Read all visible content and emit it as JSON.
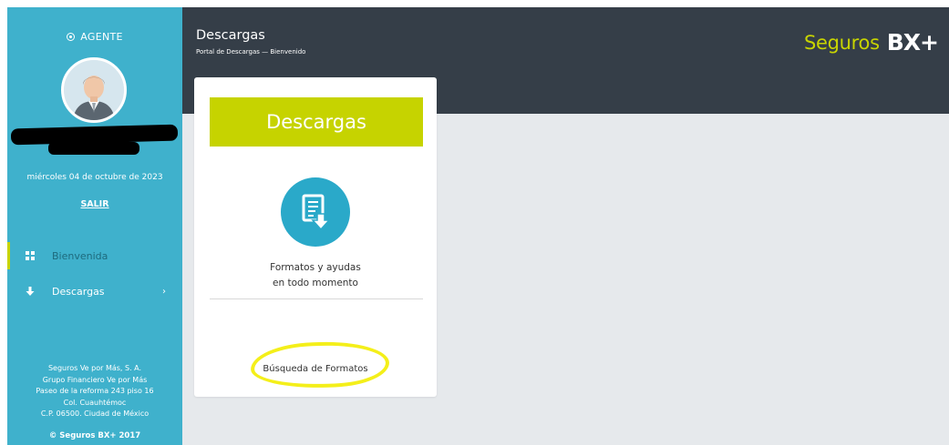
{
  "sidebar": {
    "agent_label": "AGENTE",
    "date": "miércoles 04 de octubre de 2023",
    "logout": "SALIR",
    "nav": {
      "home": "Bienvenida",
      "downloads": "Descargas"
    },
    "footer": {
      "line1": "Seguros Ve por Más, S. A.",
      "line2": "Grupo Financiero Ve por Más",
      "line3": "Paseo de la reforma 243 piso 16",
      "line4": "Col. Cuauhtémoc",
      "line5": "C.P. 06500. Ciudad de México"
    },
    "copyright": "© Seguros BX+ 2017"
  },
  "header": {
    "title": "Descargas",
    "subtitle": "Portal de Descargas — Bienvenido",
    "brand_word": "Seguros",
    "brand_mark": "BX+"
  },
  "card": {
    "banner": "Descargas",
    "text_line1": "Formatos y ayudas",
    "text_line2": "en todo momento",
    "link": "Búsqueda de Formatos"
  },
  "colors": {
    "sidebar": "#3fb1cc",
    "header": "#353e48",
    "brand_green": "#c6d300",
    "icon_circle": "#2aa9c9",
    "highlight": "#f4ef1a",
    "content_bg": "#e6e9ec"
  },
  "icons": {
    "agent": "radio-dot-icon",
    "home": "dashboard-grid-icon",
    "downloads": "arrow-down-icon",
    "chevron": "chevron-right-icon",
    "card": "document-download-icon"
  }
}
